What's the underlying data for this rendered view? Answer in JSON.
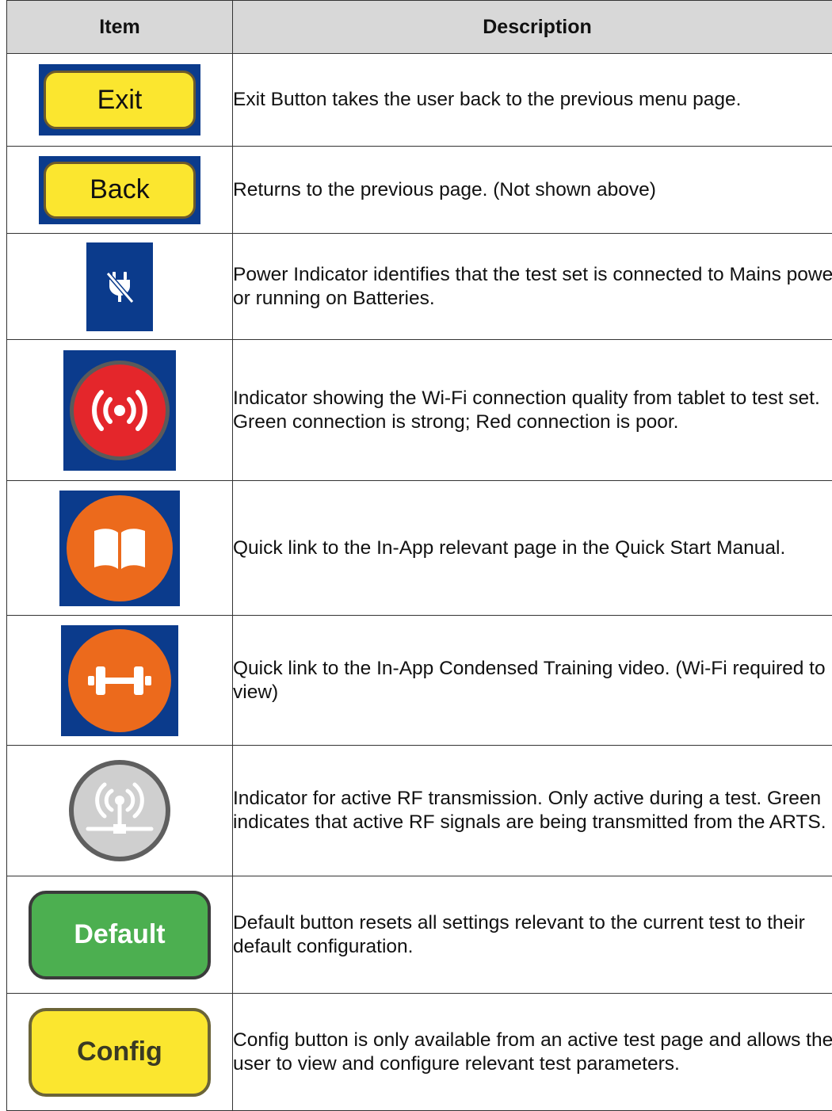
{
  "table": {
    "headers": {
      "item": "Item",
      "description": "Description"
    },
    "rows": [
      {
        "item_label": "Exit",
        "description": "Exit Button takes the user back to the previous menu page."
      },
      {
        "item_label": "Back",
        "description": "Returns to the previous page. (Not shown above)"
      },
      {
        "icon": "power-unplugged-icon",
        "description": "Power Indicator identifies that the test set is connected to Mains power or running on Batteries."
      },
      {
        "icon": "wifi-signal-icon",
        "description": "Indicator showing the Wi-Fi connection quality from tablet to test set. Green connection is strong; Red connection is poor."
      },
      {
        "icon": "book-icon",
        "description": "Quick link to the In-App relevant page in the Quick Start Manual."
      },
      {
        "icon": "dumbbell-icon",
        "description": "Quick link to the In-App Condensed Training video. (Wi-Fi required to view)"
      },
      {
        "icon": "rf-antenna-icon",
        "description": "Indicator for active RF transmission. Only active during a test. Green indicates that active RF signals are being transmitted from the ARTS."
      },
      {
        "item_label": "Default",
        "description": "Default button resets all settings relevant to the current test to their default configuration."
      },
      {
        "item_label": "Config",
        "description": "Config button is only available from an active test page and allows the user to view and configure relevant test parameters."
      }
    ]
  },
  "colors": {
    "navy": "#0b3b8c",
    "button_yellow": "#fbe62f",
    "default_green": "#4caf50",
    "wifi_red": "#e4262b",
    "quicklink_orange": "#ec6a1c",
    "rf_grey": "#cfcfcf",
    "header_grey": "#d8d8d8"
  }
}
